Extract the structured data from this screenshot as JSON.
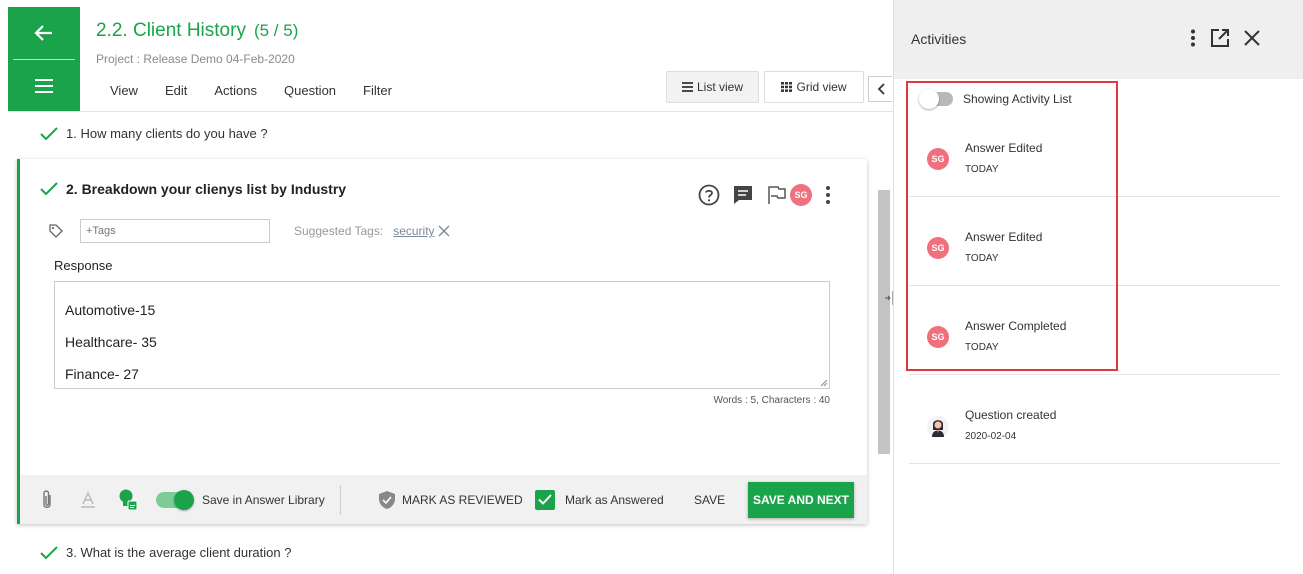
{
  "header": {
    "title": "2.2. Client History",
    "count": "(5 / 5)",
    "project": "Project : Release Demo 04-Feb-2020",
    "menu": [
      "View",
      "Edit",
      "Actions",
      "Question",
      "Filter"
    ],
    "list_view": "List view",
    "grid_view": "Grid view"
  },
  "questions": {
    "q1": "1. How many clients do you have ?",
    "q2": "2. Breakdown your clienys list by Industry",
    "q3": "3. What is the average client duration ?"
  },
  "card": {
    "avatar": "SG",
    "tags_placeholder": "+Tags",
    "suggested_label": "Suggested Tags:",
    "suggested_tag": "security",
    "response_label": "Response",
    "response_lines": [
      "Automotive-15",
      "Healthcare- 35",
      "Finance- 27"
    ],
    "word_count": "Words : 5, Characters : 40"
  },
  "footer": {
    "save_library": "Save in Answer Library",
    "mark_reviewed": "MARK AS REVIEWED",
    "mark_answered": "Mark as Answered",
    "save": "SAVE",
    "save_next": "SAVE AND NEXT"
  },
  "activities": {
    "title": "Activities",
    "toggle_label": "Showing Activity List",
    "items": [
      {
        "avatar": "SG",
        "name": "Answer Edited",
        "when": "TODAY"
      },
      {
        "avatar": "SG",
        "name": "Answer Edited",
        "when": "TODAY"
      },
      {
        "avatar": "SG",
        "name": "Answer Completed",
        "when": "TODAY"
      },
      {
        "avatar": "",
        "name": "Question created",
        "when": "2020-02-04"
      }
    ]
  },
  "colors": {
    "accent": "#1aa34a",
    "avatar": "#f0707e",
    "highlight": "#e0383e"
  }
}
